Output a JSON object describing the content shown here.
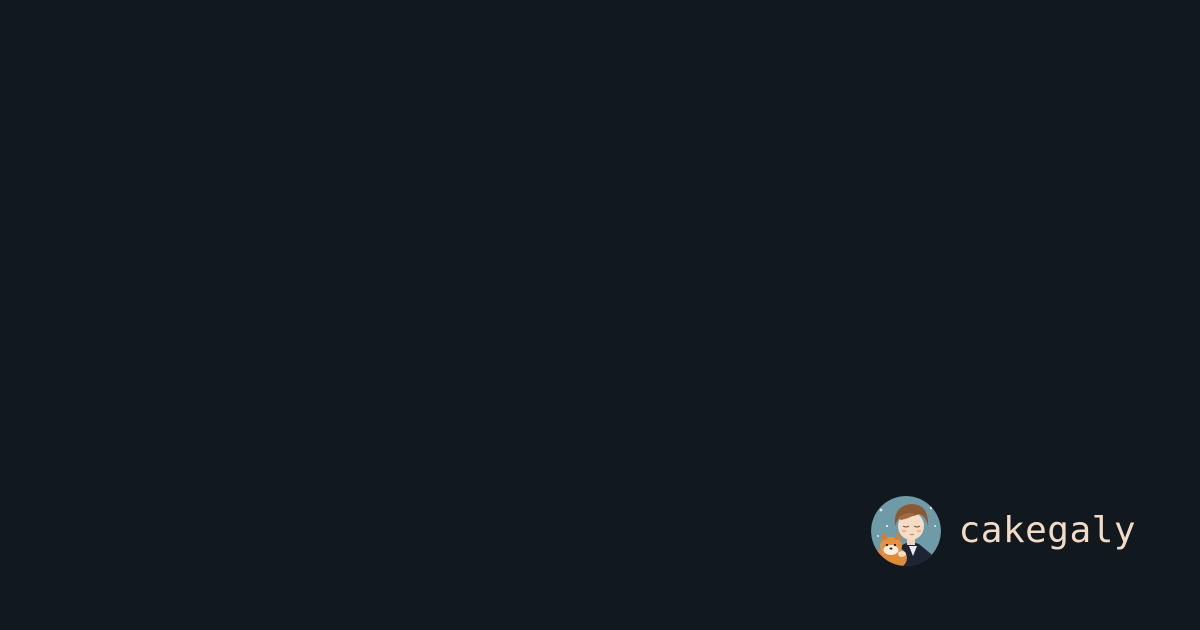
{
  "theme": {
    "background": "#12191e",
    "text": "#f3dcc7"
  },
  "title": "",
  "author": {
    "name": "cakegaly",
    "avatar_icon": "avatar-illustration-person-with-dog"
  }
}
